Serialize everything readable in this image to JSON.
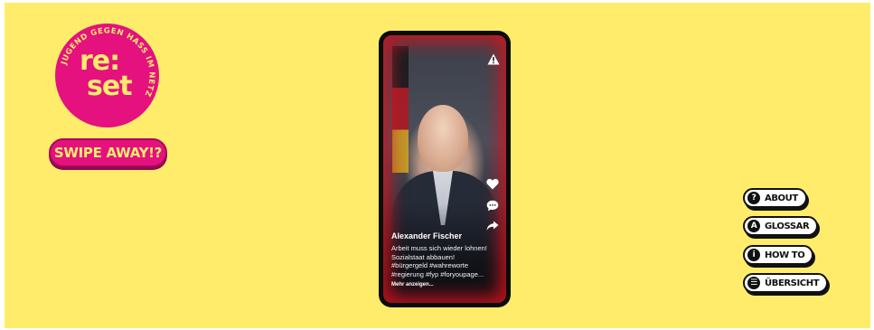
{
  "logo": {
    "line1": "re:",
    "line2": "set",
    "arc_text": "JUGEND GEGEN HASS IM NETZ"
  },
  "swipe_button": {
    "label": "SWIPE AWAY!?"
  },
  "post": {
    "author": "Alexander Fischer",
    "caption_lines": [
      "Arbeit muss sich wieder lohnen!",
      "Sozialstaat abbauen!",
      "#bürgergeld #wahreworte",
      "#regierung #fyp #foryoupage..."
    ],
    "more_label": "Mehr anzeigen..."
  },
  "icons": {
    "report": "warning-icon",
    "like": "heart-icon",
    "comment": "comment-icon",
    "share": "share-icon"
  },
  "menu": {
    "items": [
      {
        "label": "ABOUT",
        "glyph": "?",
        "icon": "question-icon"
      },
      {
        "label": "GLOSSAR",
        "glyph": "A",
        "icon": "glossary-icon"
      },
      {
        "label": "HOW TO",
        "glyph": "i",
        "icon": "info-icon"
      },
      {
        "label": "ÜBERSICHT",
        "glyph": "☰",
        "icon": "list-icon"
      }
    ]
  },
  "colors": {
    "background": "#ffec6b",
    "brand_pink": "#e4117e",
    "brand_yellow": "#ffec6b"
  }
}
